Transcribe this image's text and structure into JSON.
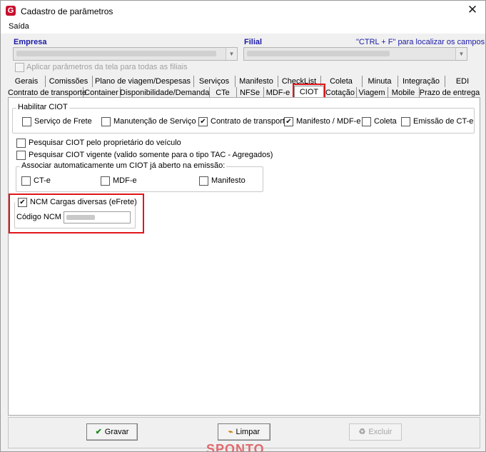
{
  "window": {
    "title": "Cadastro de parâmetros",
    "close_glyph": "✕"
  },
  "menu": {
    "saida": "Saída"
  },
  "empresa": {
    "label": "Empresa"
  },
  "filial": {
    "label": "Filial"
  },
  "hint": "\"CTRL + F\" para localizar os campos",
  "apply_all": {
    "label": "Aplicar parâmetros da tela para todas as filiais",
    "checked": false,
    "enabled": false
  },
  "tabs_row1": [
    "Gerais",
    "Comissões",
    "Plano de viagem/Despesas",
    "Serviços",
    "Manifesto",
    "CheckList",
    "Coleta",
    "Minuta",
    "Integração",
    "EDI"
  ],
  "tabs_row2": [
    "Contrato de transporte",
    "Container",
    "Disponibilidade/Demanda",
    "CTe",
    "NFSe",
    "MDF-e",
    "CIOT",
    "Cotação",
    "Viagem",
    "Mobile",
    "Prazo de entrega"
  ],
  "active_tab": "CIOT",
  "habilitar": {
    "title": "Habilitar CIOT",
    "items": [
      {
        "label": "Serviço de Frete",
        "checked": false
      },
      {
        "label": "Manutenção de Serviço",
        "checked": false
      },
      {
        "label": "Contrato de transporte",
        "checked": true
      },
      {
        "label": "Manifesto / MDF-e",
        "checked": true
      },
      {
        "label": "Coleta",
        "checked": false
      },
      {
        "label": "Emissão de CT-e",
        "checked": false
      }
    ]
  },
  "pesquisar_proprietario": {
    "label": "Pesquisar CIOT pelo proprietário do veículo",
    "checked": false
  },
  "pesquisar_vigente": {
    "label": "Pesquisar CIOT vigente (valido somente para o tipo TAC - Agregados)",
    "checked": false
  },
  "associar": {
    "title": "Associar automaticamente um CIOT já aberto na emissão:",
    "items": [
      {
        "label": "CT-e",
        "checked": false
      },
      {
        "label": "MDF-e",
        "checked": false
      },
      {
        "label": "Manifesto",
        "checked": false
      }
    ]
  },
  "ncm": {
    "title": "NCM Cargas diversas (eFrete)",
    "checked": true,
    "codigo_label": "Código NCM"
  },
  "buttons": {
    "gravar": "Gravar",
    "limpar": "Limpar",
    "excluir": "Excluir"
  },
  "colors": {
    "highlight": "#e0161b",
    "hint": "#1a1aa6",
    "logo": "#c8102e"
  },
  "watermark": "SPONTO"
}
